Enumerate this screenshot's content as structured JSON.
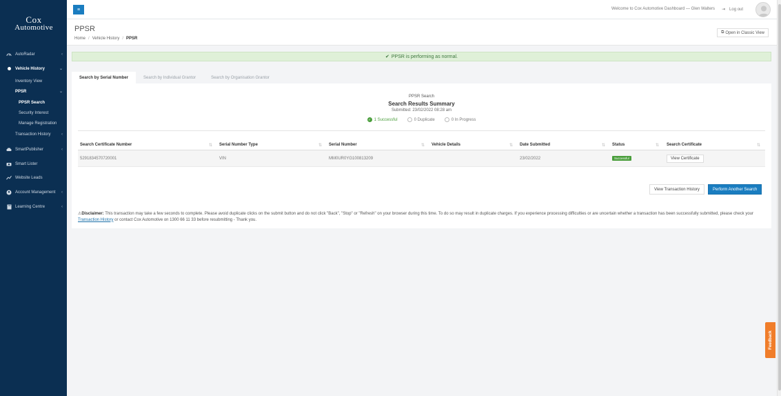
{
  "logo": {
    "line1": "Cox",
    "line2": "Automotive"
  },
  "sidebar": {
    "items": [
      {
        "label": "AutoRadar",
        "icon": "gauge-icon"
      },
      {
        "label": "Vehicle History",
        "icon": "dot-icon"
      },
      {
        "label": "Inventory View"
      },
      {
        "label": "PPSR"
      },
      {
        "label": "PPSR Search"
      },
      {
        "label": "Security Interest"
      },
      {
        "label": "Manage Registration"
      },
      {
        "label": "Transaction History"
      },
      {
        "label": "SmartPublisher",
        "icon": "car-icon"
      },
      {
        "label": "Smart Lister",
        "icon": "camera-icon"
      },
      {
        "label": "Website Leads",
        "icon": "chart-icon"
      },
      {
        "label": "Account Management",
        "icon": "user-icon"
      },
      {
        "label": "Learning Centre",
        "icon": "book-icon"
      }
    ]
  },
  "topbar": {
    "welcome": "Welcome to Cox Automotive Dashboard — Glen Walters",
    "logout": "Log out"
  },
  "page": {
    "title": "PPSR",
    "breadcrumb": [
      "Home",
      "Vehicle History",
      "PPSR"
    ],
    "classic_view": "Open in Classic View"
  },
  "alert": {
    "text": "PPSR is performing as normal."
  },
  "tabs": [
    "Search by Serial Number",
    "Search by Individual Grantor",
    "Search by Organisation Grantor"
  ],
  "summary": {
    "label": "PPSR Search",
    "title": "Search Results Summary",
    "submitted": "Submitted: 23/02/2022 08:28 am",
    "successful": "1 Successful",
    "duplicate": "0 Duplicate",
    "in_progress": "0 In Progress"
  },
  "table": {
    "headers": [
      "Search Certificate Number",
      "Serial Number Type",
      "Serial Number",
      "Vehicle Details",
      "Date Submitted",
      "Status",
      "Search Certificate"
    ],
    "rows": [
      {
        "cert": "5291834570720001",
        "type": "VIN",
        "serial": "MM0UR0YG100813209",
        "details": "",
        "date": "23/02/2022",
        "status": "Successful",
        "action": "View Certificate"
      }
    ]
  },
  "buttons": {
    "view_history": "View Transaction History",
    "perform_search": "Perform Another Search"
  },
  "disclaimer": {
    "label": "Disclaimer:",
    "text1": " This transaction may take a few seconds to complete. Please avoid duplicate clicks on the submit button and do not click \"Back\", \"Stop\" or \"Refresh\" on your browser during this time. To do so may result in duplicate charges. If you experience processing difficulties or are uncertain whether a transaction has been successfully submitted, please check your ",
    "link": "Transaction History",
    "text2": " or contact Cox Automotive on 1300 66 11 33 before resubmitting - Thank you."
  },
  "feedback": "Feedback",
  "colors": {
    "sidebar_bg": "#0b2f52",
    "primary": "#1a7dc0",
    "success": "#4a9e3c",
    "alert_bg": "#dff0d8",
    "feedback": "#f07d2a"
  }
}
